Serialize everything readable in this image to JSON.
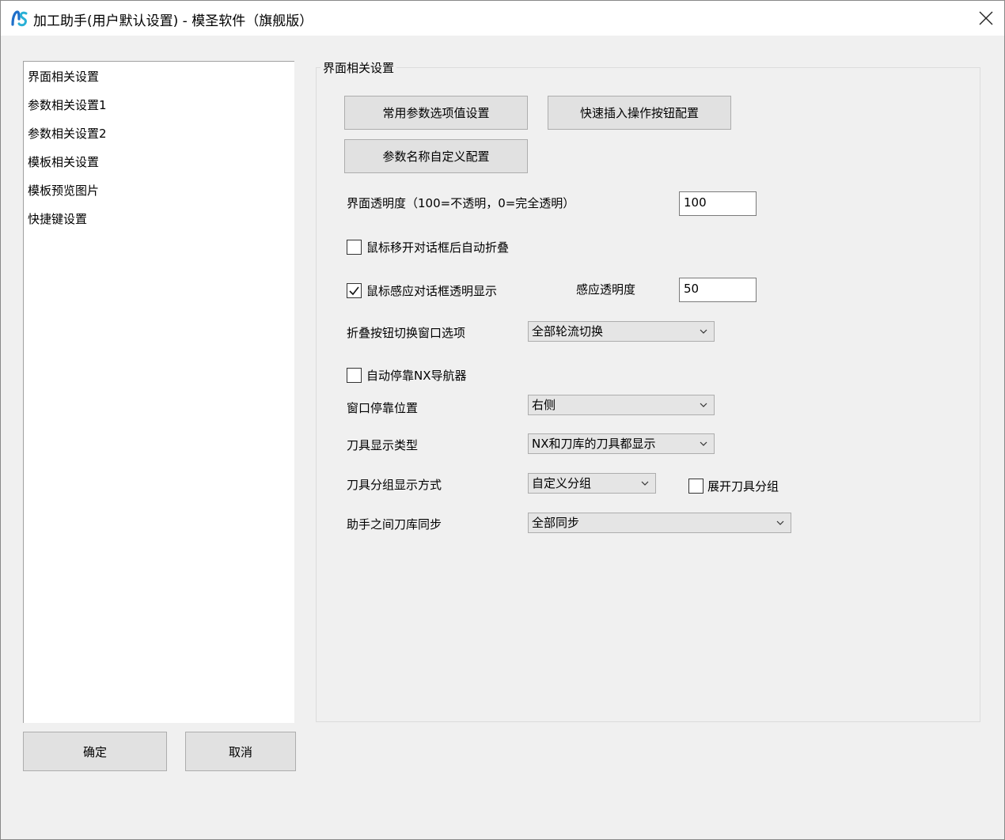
{
  "window": {
    "title": "加工助手(用户默认设置) - 模圣软件（旗舰版）",
    "close_icon": "close-icon",
    "app_icon": "app-logo-icon"
  },
  "nav": {
    "items": [
      {
        "label": "界面相关设置"
      },
      {
        "label": "参数相关设置1"
      },
      {
        "label": "参数相关设置2"
      },
      {
        "label": "模板相关设置"
      },
      {
        "label": "模板预览图片"
      },
      {
        "label": "快捷键设置"
      }
    ]
  },
  "footer": {
    "ok_label": "确定",
    "cancel_label": "取消"
  },
  "group": {
    "title": "界面相关设置",
    "buttons": {
      "common_params": "常用参数选项值设置",
      "quick_insert": "快速插入操作按钮配置",
      "param_names": "参数名称自定义配置"
    },
    "transparency": {
      "label": "界面透明度（100=不透明，0=完全透明）",
      "value": "100"
    },
    "auto_fold": {
      "label": "鼠标移开对话框后自动折叠",
      "checked": false
    },
    "hover_transparent": {
      "label": "鼠标感应对话框透明显示",
      "checked": true,
      "sense_label": "感应透明度",
      "sense_value": "50"
    },
    "fold_switch": {
      "label": "折叠按钮切换窗口选项",
      "value": "全部轮流切换"
    },
    "auto_dock": {
      "label": "自动停靠NX导航器",
      "checked": false
    },
    "dock_position": {
      "label": "窗口停靠位置",
      "value": "右侧"
    },
    "tool_display": {
      "label": "刀具显示类型",
      "value": "NX和刀库的刀具都显示"
    },
    "tool_group": {
      "label": "刀具分组显示方式",
      "value": "自定义分组",
      "expand_label": "展开刀具分组",
      "expand_checked": false
    },
    "tool_sync": {
      "label": "助手之间刀库同步",
      "value": "全部同步"
    }
  }
}
